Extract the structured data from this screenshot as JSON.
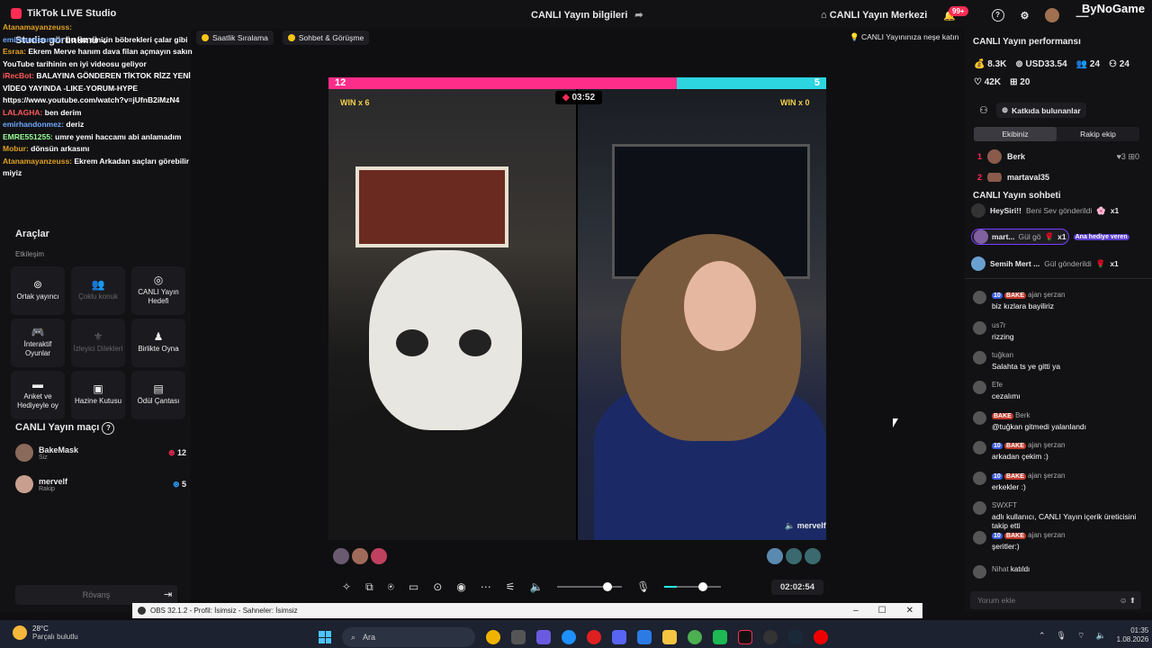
{
  "titlebar": {
    "app": "TikTok LIVE Studio",
    "center": "CANLI Yayın bilgileri",
    "center_icon": "share-icon",
    "center_mgr": "CANLI Yayın Merkezi",
    "notif": "99+",
    "logo": "ByNoGame"
  },
  "left": {
    "studio_view": "Studio görünümü",
    "chat_overlay": [
      {
        "user": "Atanamayanzeuss:",
        "text": "",
        "cls": "n1"
      },
      {
        "user": "emirhandonmez:",
        "text": "bu kız emirin böbrekleri çalar gibi",
        "cls": "n2"
      },
      {
        "user": "Esraa:",
        "text": "Ekrem Merve hanım dava filan açmayın sakın",
        "cls": "n1"
      },
      {
        "user": "",
        "text": "YouTube tarihinin en iyi videosu geliyor",
        "cls": ""
      },
      {
        "user": "iRecBot:",
        "text": "BALAYINA GÖNDEREN TİKTOK RİZZ YENİ",
        "cls": "n3"
      },
      {
        "user": "",
        "text": "VİDEO YAYINDA -LIKE-YORUM-HYPE",
        "cls": ""
      },
      {
        "user": "",
        "text": "https://www.youtube.com/watch?v=jUfnB2iMzN4",
        "cls": ""
      },
      {
        "user": "LALAGHA:",
        "text": "ben derim",
        "cls": "n3"
      },
      {
        "user": "emirhandonmez:",
        "text": "deriz",
        "cls": "n2"
      },
      {
        "user": "EMRE551255:",
        "text": "umre yemi haccamı abi anlamadım",
        "cls": "n4"
      },
      {
        "user": "Mobur:",
        "text": "dönsün arkasını",
        "cls": "n1"
      },
      {
        "user": "Atanamayanzeuss:",
        "text": "Ekrem Arkadan saçları görebilir",
        "cls": "n1"
      },
      {
        "user": "",
        "text": "miyiz",
        "cls": ""
      }
    ],
    "tools_title": "Araçlar",
    "engagement": "Etkileşim",
    "tools": [
      "Ortak yayıncı",
      "Çoklu konuk",
      "CANLI Yayın Hedefi",
      "İnteraktif Oyunlar",
      "İzleyici Dilekleri",
      "Birlikte Oyna",
      "Anket ve Hediyeyle oy",
      "Hazine Kutusu",
      "Ödül Çantası"
    ],
    "match_title": "CANLI Yayın maçı",
    "p1": {
      "name": "BakeMask",
      "sub": "Siz",
      "score": "12"
    },
    "p2": {
      "name": "mervelf",
      "sub": "Rakip",
      "score": "5"
    },
    "rematch": "Rövanş"
  },
  "tabs": {
    "ranking": "Saatlik Sıralama",
    "chat": "Sohbet & Görüşme",
    "tip": "CANLI Yayınınıza neşe katın"
  },
  "battle": {
    "left": "12",
    "right": "5",
    "timer": "03:52",
    "win_left": "WIN x 6",
    "win_right": "WIN x 0",
    "opponent": "mervelf"
  },
  "controls": {
    "elapsed": "02:02:54",
    "volume_level": 0.7,
    "mic_level": 0.6
  },
  "right": {
    "perf_title": "CANLI Yayın performansı",
    "stats1": [
      "8.3K",
      "USD33.54",
      "24",
      "24"
    ],
    "stats2": [
      "42K",
      "20"
    ],
    "contributors": "Katkıda bulunanlar",
    "seg": [
      "Ekibiniz",
      "Rakip ekip"
    ],
    "rank": [
      {
        "n": "1",
        "name": "Berk",
        "l": "3",
        "r": "0"
      },
      {
        "n": "2",
        "name": "martaval35",
        "l": "",
        "r": ""
      }
    ],
    "chat_title": "CANLI Yayın sohbeti",
    "gifts": [
      {
        "user": "HeySiri!!",
        "act": "Beni Sev gönderildi",
        "x": "x1",
        "badge": ""
      },
      {
        "user": "mart...",
        "act": "Gül gö",
        "x": "x1",
        "badge": "Ana hediye veren"
      },
      {
        "user": "Semih Mert ...",
        "act": "Gül gönderildi",
        "x": "x1",
        "badge": ""
      }
    ],
    "msgs": [
      {
        "lv": "10",
        "bake": "BAKE",
        "user": "ajan şerzan",
        "text": "biz kızlara bayiliriz"
      },
      {
        "lv": "",
        "bake": "",
        "user": "us7r",
        "text": "rizzing"
      },
      {
        "lv": "",
        "bake": "",
        "user": "tuğkan",
        "text": "Salahta ts ye gitti ya"
      },
      {
        "lv": "",
        "bake": "",
        "user": "Efe",
        "text": "cezalımı"
      },
      {
        "lv": "",
        "bake": "BAKE",
        "user": "Berk",
        "text": "@tuğkan gitmedi yalanlandı"
      },
      {
        "lv": "10",
        "bake": "BAKE",
        "user": "ajan şerzan",
        "text": "arkadan çekim :)"
      },
      {
        "lv": "10",
        "bake": "BAKE",
        "user": "ajan şerzan",
        "text": "erkekler :)"
      },
      {
        "lv": "",
        "bake": "",
        "user": "SWXFT",
        "text": "adlı kullanıcı, CANLI Yayın içerik üreticisini takip etti"
      },
      {
        "lv": "10",
        "bake": "BAKE",
        "user": "ajan şerzan",
        "text": "şeritler:)"
      },
      {
        "lv": "",
        "bake": "",
        "user": "Nihat",
        "text": "katıldı"
      }
    ],
    "input_ph": "Yorum ekle"
  },
  "obs": {
    "title": "OBS 32.1.2 - Profil: İsimsiz - Sahneler: İsimsiz"
  },
  "taskbar": {
    "temp": "28°C",
    "weather": "Parçalı bulutlu",
    "search": "Ara",
    "time": "01:35",
    "date": "1.08.2026"
  }
}
